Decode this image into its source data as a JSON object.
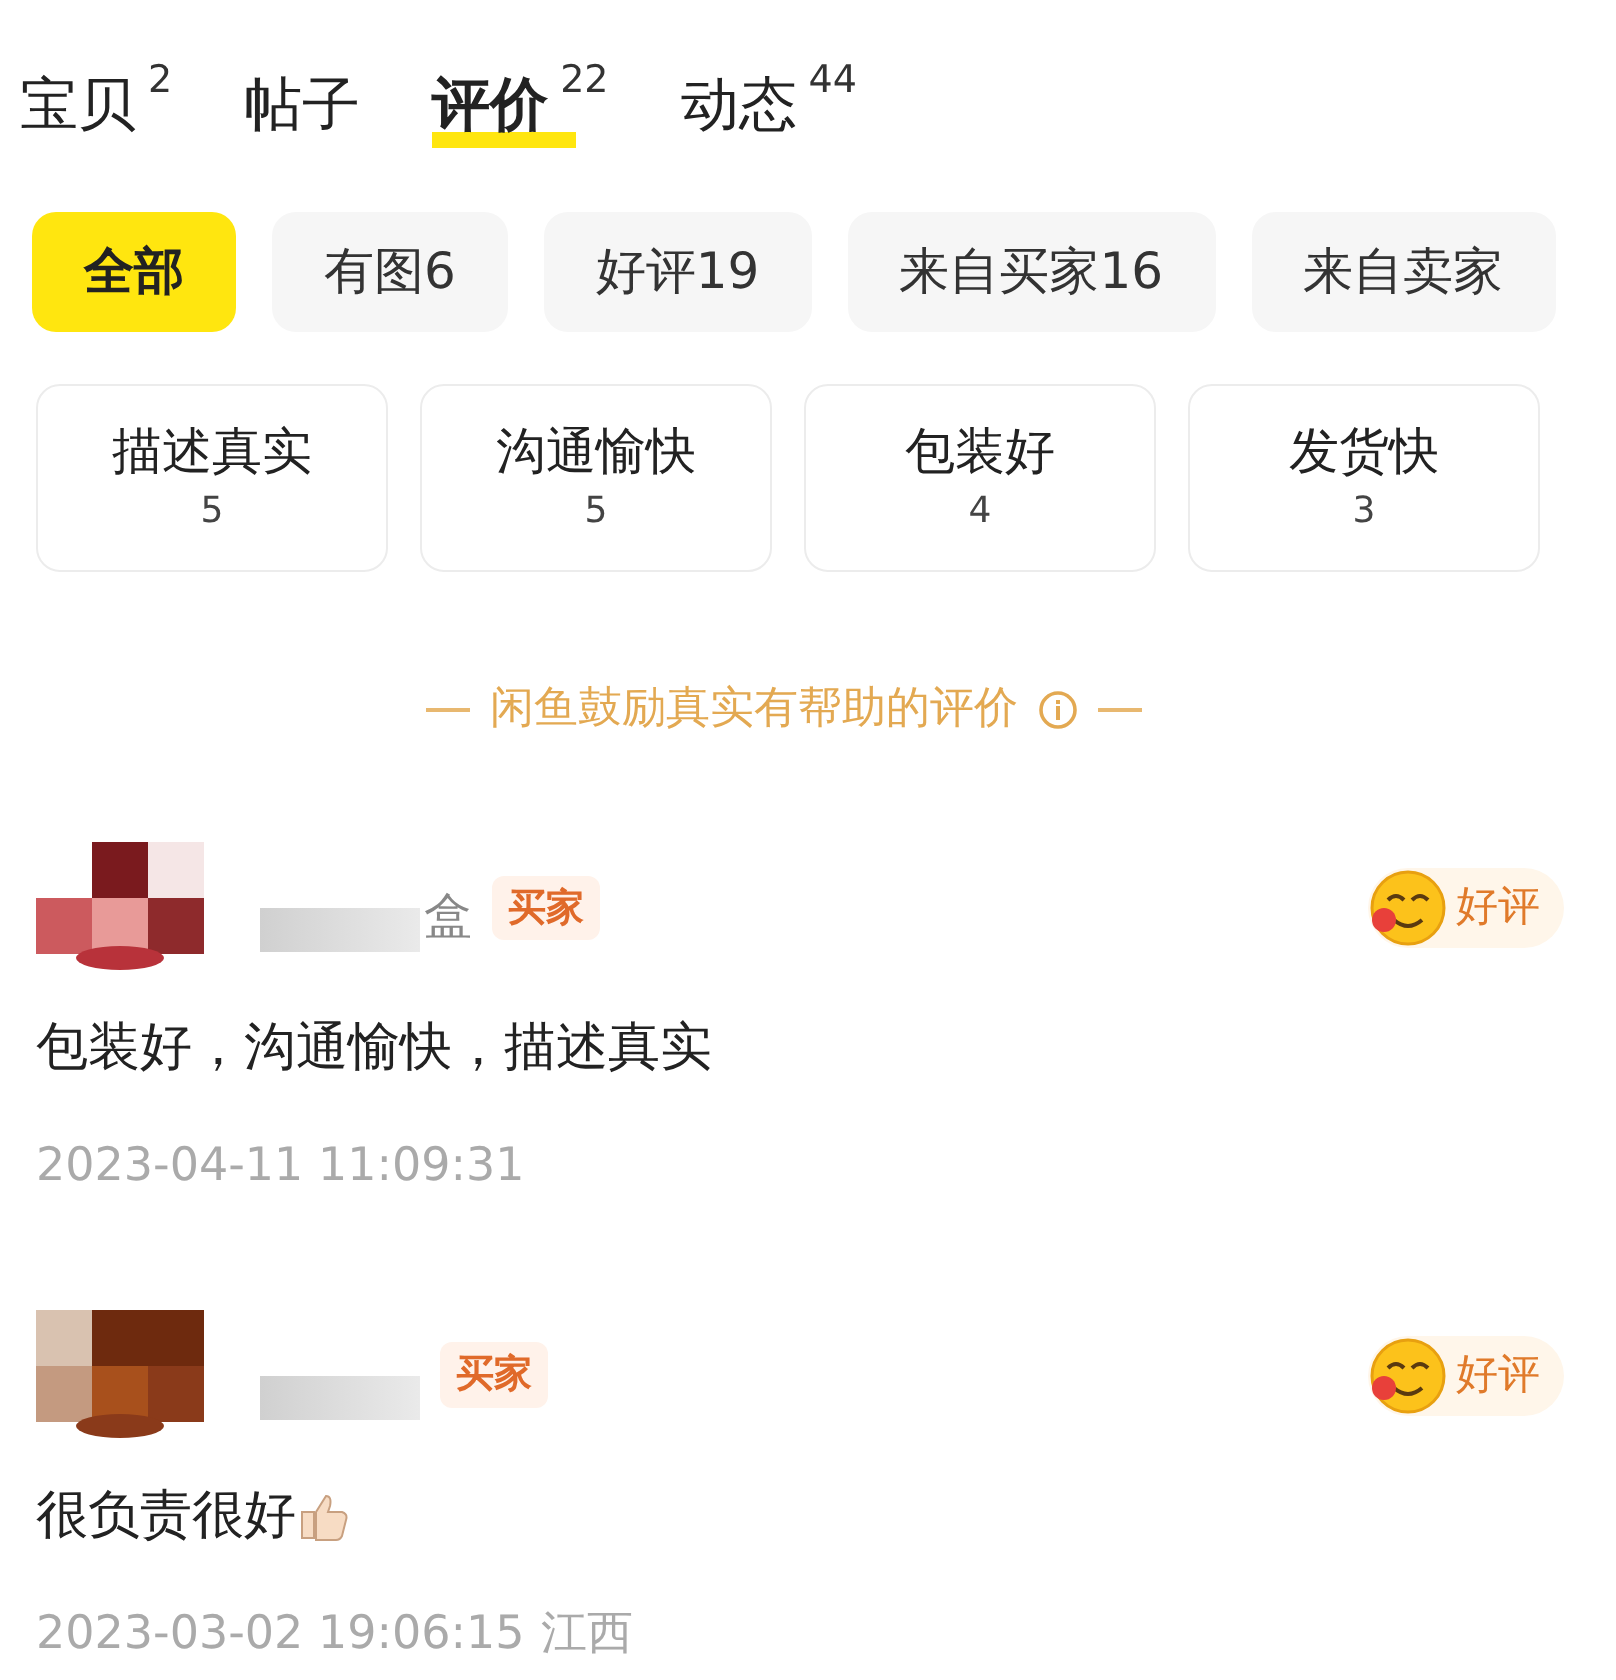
{
  "tabs": [
    {
      "label": "宝贝",
      "count": "2",
      "selected": false
    },
    {
      "label": "帖子",
      "selected": false
    },
    {
      "label": "评价",
      "count": "22",
      "selected": true
    },
    {
      "label": "动态",
      "count": "44",
      "selected": false
    }
  ],
  "filters": [
    {
      "label": "全部",
      "selected": true
    },
    {
      "label": "有图6",
      "selected": false
    },
    {
      "label": "好评19",
      "selected": false
    },
    {
      "label": "来自买家16",
      "selected": false
    },
    {
      "label": "来自卖家",
      "selected": false
    }
  ],
  "tags": [
    {
      "label": "描述真实",
      "count": "5"
    },
    {
      "label": "沟通愉快",
      "count": "5"
    },
    {
      "label": "包装好",
      "count": "4"
    },
    {
      "label": "发货快",
      "count": "3"
    }
  ],
  "notice": "闲鱼鼓励真实有帮助的评价",
  "reviews": [
    {
      "name_suffix": "盒",
      "role": "买家",
      "rating": "好评",
      "text": "包装好，沟通愉快，描述真实",
      "thumbs_up": false,
      "time": "2023-04-11 11:09:31"
    },
    {
      "role": "买家",
      "rating": "好评",
      "text": "很负责很好",
      "thumbs_up": true,
      "time": "2023-03-02 19:06:15",
      "location": "江西"
    }
  ]
}
